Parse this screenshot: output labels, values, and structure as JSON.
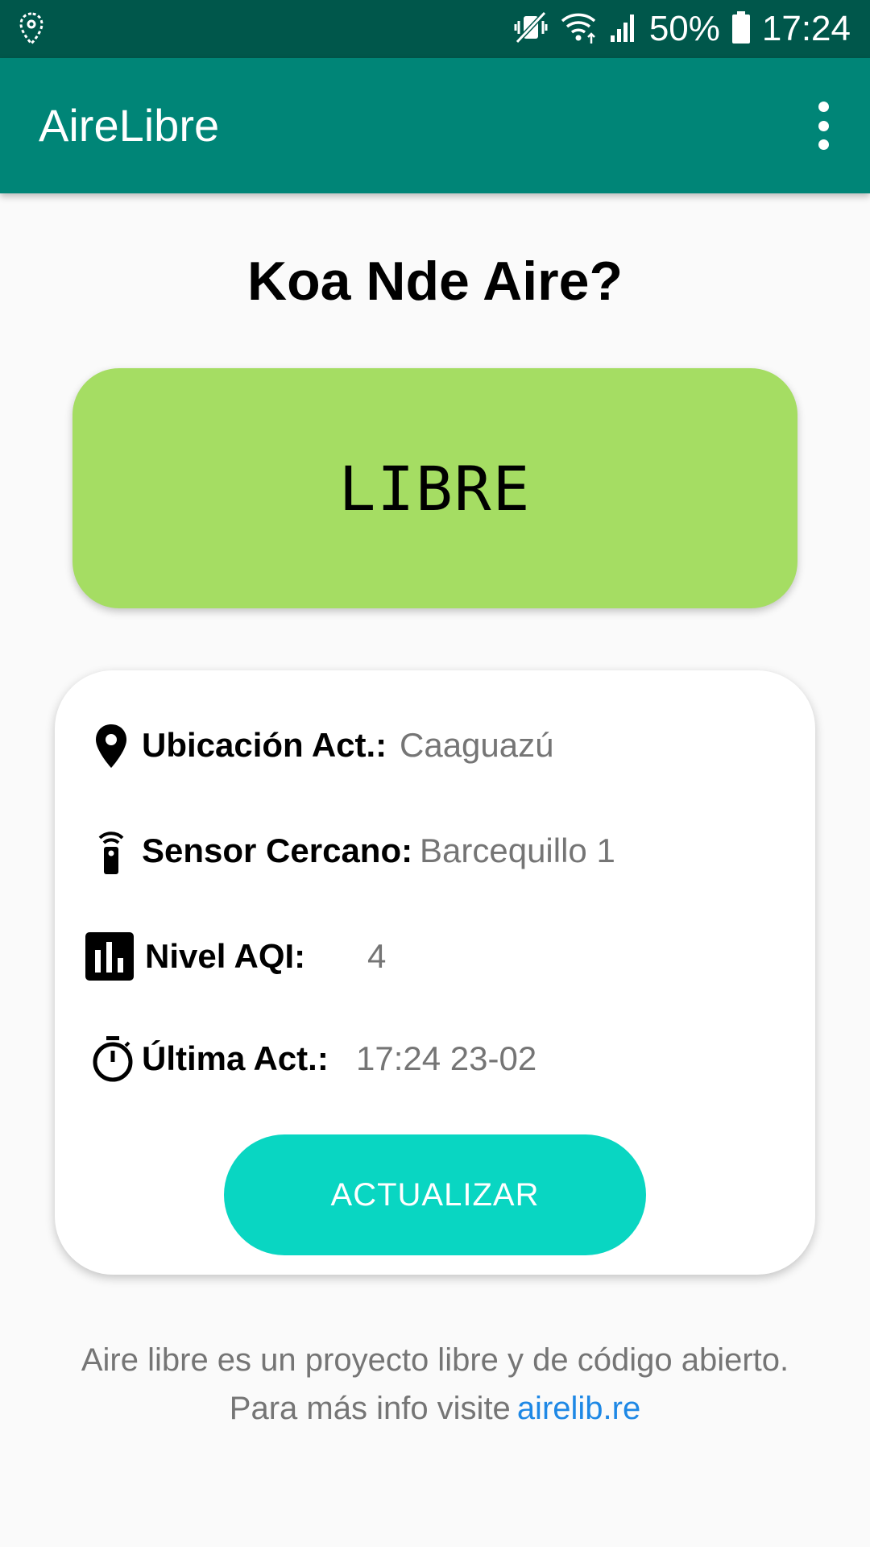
{
  "status_bar": {
    "left_icon": "location-pin-outline-icon",
    "icons": [
      "vibrate-mute-icon",
      "wifi-icon",
      "cell-signal-icon"
    ],
    "battery_percent": "50%",
    "battery_icon": "battery-icon",
    "time": "17:24"
  },
  "app_bar": {
    "title": "AireLibre",
    "menu_icon": "more-vert-icon"
  },
  "main": {
    "heading": "Koa Nde Aire?",
    "air_status": {
      "text": "LIBRE",
      "color": "#a5dd63"
    },
    "info": {
      "rows": [
        {
          "icon": "location-pin-icon",
          "label": "Ubicación Act.:",
          "value": "Caaguazú"
        },
        {
          "icon": "sensor-remote-icon",
          "label": "Sensor Cercano:",
          "value": "Barcequillo 1"
        },
        {
          "icon": "bar-chart-icon",
          "label": "Nivel AQI:",
          "value": "4"
        },
        {
          "icon": "timer-icon",
          "label": "Última Act.:",
          "value": "17:24 23-02"
        }
      ],
      "button_label": "ACTUALIZAR",
      "button_color": "#09d6c2"
    }
  },
  "footer": {
    "line1": "Aire libre es un proyecto libre y de código abierto.",
    "line2_prefix": "Para más info visite",
    "link_text": "airelib.re"
  },
  "colors": {
    "status_bar": "#00574b",
    "app_bar": "#008577",
    "link": "#1e88e5"
  }
}
